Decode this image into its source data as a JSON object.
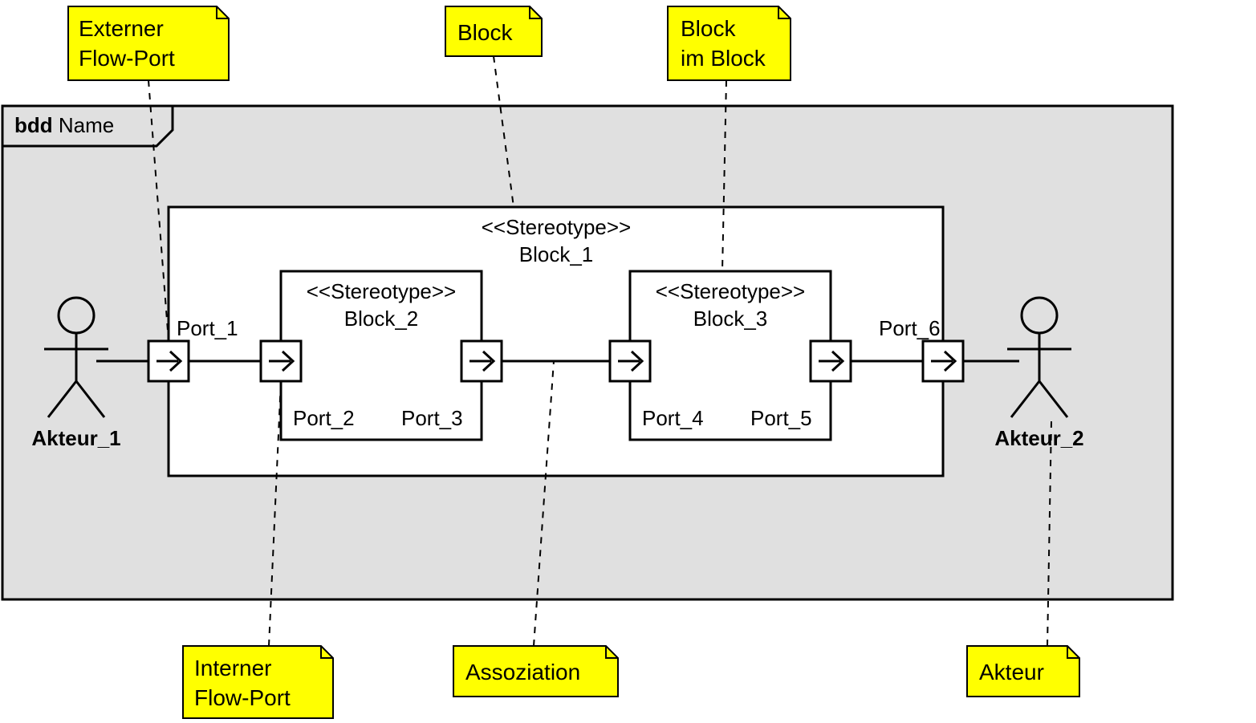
{
  "notes": {
    "externFlowPort": {
      "line1": "Externer",
      "line2": "Flow-Port"
    },
    "block": {
      "line1": "Block"
    },
    "blockImBlock": {
      "line1": "Block",
      "line2": "im Block"
    },
    "internFlowPort": {
      "line1": "Interner",
      "line2": "Flow-Port"
    },
    "assoziation": {
      "line1": "Assoziation"
    },
    "akteur": {
      "line1": "Akteur"
    }
  },
  "frame": {
    "kind": "bdd",
    "name": "Name"
  },
  "block1": {
    "stereotype": "<<Stereotype>>",
    "name": "Block_1"
  },
  "block2": {
    "stereotype": "<<Stereotype>>",
    "name": "Block_2"
  },
  "block3": {
    "stereotype": "<<Stereotype>>",
    "name": "Block_3"
  },
  "ports": {
    "p1": "Port_1",
    "p2": "Port_2",
    "p3": "Port_3",
    "p4": "Port_4",
    "p5": "Port_5",
    "p6": "Port_6"
  },
  "actors": {
    "a1": "Akteur_1",
    "a2": "Akteur_2"
  }
}
